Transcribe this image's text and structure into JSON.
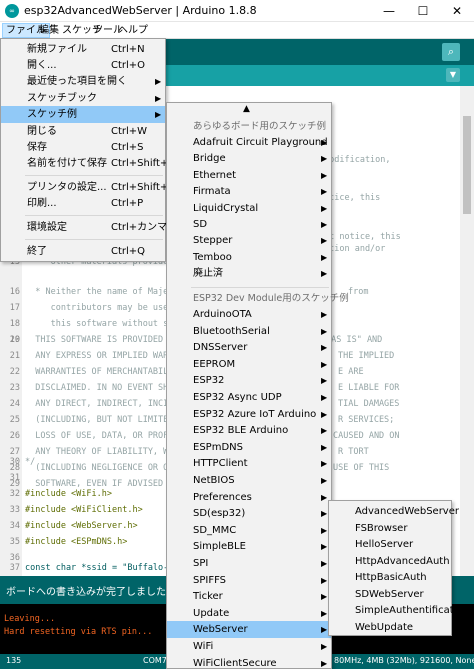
{
  "window": {
    "title": "esp32AdvancedWebServer | Arduino 1.8.8",
    "icon": "∞",
    "minimize": "—",
    "maximize": "☐",
    "close": "✕"
  },
  "menubar": {
    "items": [
      "ファイル",
      "編集",
      "スケッチ",
      "ツール",
      "ヘルプ"
    ]
  },
  "toolbar": {
    "serial_icon": "⌕",
    "tab_menu_icon": "▼"
  },
  "file_menu": {
    "items": [
      {
        "label": "新規ファイル",
        "shortcut": "Ctrl+N"
      },
      {
        "label": "開く...",
        "shortcut": "Ctrl+O"
      },
      {
        "label": "最近使った項目を開く",
        "shortcut": ""
      },
      {
        "label": "スケッチブック",
        "shortcut": ""
      },
      {
        "label": "スケッチ例",
        "shortcut": ""
      },
      {
        "label": "閉じる",
        "shortcut": "Ctrl+W"
      },
      {
        "label": "保存",
        "shortcut": "Ctrl+S"
      },
      {
        "label": "名前を付けて保存",
        "shortcut": "Ctrl+Shift+S"
      },
      {
        "label": "プリンタの設定...",
        "shortcut": "Ctrl+Shift+P"
      },
      {
        "label": "印刷...",
        "shortcut": "Ctrl+P"
      },
      {
        "label": "環境設定",
        "shortcut": "Ctrl+カンマ"
      },
      {
        "label": "終了",
        "shortcut": "Ctrl+Q"
      }
    ]
  },
  "examples_menu": {
    "scroll_up": "▲",
    "header_all": "あらゆるボード用のスケッチ例",
    "header_esp32": "ESP32 Dev Module用のスケッチ例",
    "general": [
      "Adafruit Circuit Playground",
      "Bridge",
      "Ethernet",
      "Firmata",
      "LiquidCrystal",
      "SD",
      "Stepper",
      "Temboo",
      "廃止済"
    ],
    "esp32": [
      "ArduinoOTA",
      "BluetoothSerial",
      "DNSServer",
      "EEPROM",
      "ESP32",
      "ESP32 Async UDP",
      "ESP32 Azure IoT Arduino",
      "ESP32 BLE Arduino",
      "ESPmDNS",
      "HTTPClient",
      "NetBIOS",
      "Preferences",
      "SD(esp32)",
      "SD_MMC",
      "SimpleBLE",
      "SPI",
      "SPIFFS",
      "Ticker",
      "Update",
      "WebServer",
      "WiFi",
      "WiFiClientSecure"
    ]
  },
  "webserver_menu": {
    "items": [
      "AdvancedWebServer",
      "FSBrowser",
      "HelloServer",
      "HttpAdvancedAuth",
      "HttpBasicAuth",
      "SDWebServer",
      "SimpleAuthentification",
      "WebUpdate"
    ]
  },
  "editor": {
    "visible_right_fragments": [
      {
        "line": "",
        "text": "modification,"
      },
      {
        "line": "",
        "text": "otice, this"
      },
      {
        "line": "",
        "text": "nt notice, this"
      },
      {
        "line": "",
        "text": "ation and/or"
      }
    ],
    "lines": [
      {
        "n": "13",
        "text": "     other materials provided w"
      },
      {
        "n": "16",
        "text": "  * Neither the name of Majenko"
      },
      {
        "n": "17",
        "text": "     contributors may be used to"
      },
      {
        "n": "18",
        "text": "     this software without spec"
      },
      {
        "n": "19",
        "text": ""
      },
      {
        "n": "20",
        "text": "  THIS SOFTWARE IS PROVIDED BY"
      },
      {
        "n": "21",
        "text": "  ANY EXPRESS OR IMPLIED WARRAN"
      },
      {
        "n": "22",
        "text": "  WARRANTIES OF MERCHANTABILITY"
      },
      {
        "n": "23",
        "text": "  DISCLAIMED. IN NO EVENT SHALL"
      },
      {
        "n": "24",
        "text": "  ANY DIRECT, INDIRECT, INCIDEN"
      },
      {
        "n": "25",
        "text": "  (INCLUDING, BUT NOT LIMITED T"
      },
      {
        "n": "26",
        "text": "  LOSS OF USE, DATA, OR PROFITS"
      },
      {
        "n": "27",
        "text": "  ANY THEORY OF LIABILITY, WHET"
      },
      {
        "n": "28",
        "text": "  (INCLUDING NEGLIGENCE OR OTHE"
      },
      {
        "n": "29",
        "text": "  SOFTWARE, EVEN IF ADVISED OF"
      },
      {
        "n": "30",
        "text": "*/"
      },
      {
        "n": "31",
        "text": ""
      },
      {
        "n": "32",
        "text": "#include <WiFi.h>"
      },
      {
        "n": "33",
        "text": "#include <WiFiClient.h>"
      },
      {
        "n": "34",
        "text": "#include <WebServer.h>"
      },
      {
        "n": "35",
        "text": "#include <ESPmDNS.h>"
      },
      {
        "n": "36",
        "text": ""
      },
      {
        "n": "37",
        "text": "const char *ssid = \"Buffalo-G-20"
      }
    ],
    "right_fragments": [
      {
        "n": "20",
        "text": "\"AS IS\" AND"
      },
      {
        "n": "21",
        "text": "THE IMPLIED"
      },
      {
        "n": "22",
        "text": "E ARE"
      },
      {
        "n": "23",
        "text": "E LIABLE FOR"
      },
      {
        "n": "24",
        "text": "TIAL DAMAGES"
      },
      {
        "n": "25",
        "text": "R SERVICES;"
      },
      {
        "n": "26",
        "text": "CAUSED AND ON"
      },
      {
        "n": "27",
        "text": "R TORT"
      },
      {
        "n": "28",
        "text": "USE OF THIS"
      },
      {
        "n": "16",
        "text": "from"
      }
    ]
  },
  "status": {
    "message": "ボードへの書き込みが完了しました。"
  },
  "console": {
    "lines": [
      "Leaving...",
      "Hard resetting via RTS pin..."
    ]
  },
  "bottom": {
    "line_number": "135",
    "port_fragment": "COM7",
    "board_fragment": "80MHz, 4MB (32Mb), 921600, None"
  },
  "colors": {
    "teal_dark": "#006468",
    "teal_mid": "#17a1a5",
    "menu_highlight": "#91c9f7",
    "console_text": "#f26522"
  }
}
